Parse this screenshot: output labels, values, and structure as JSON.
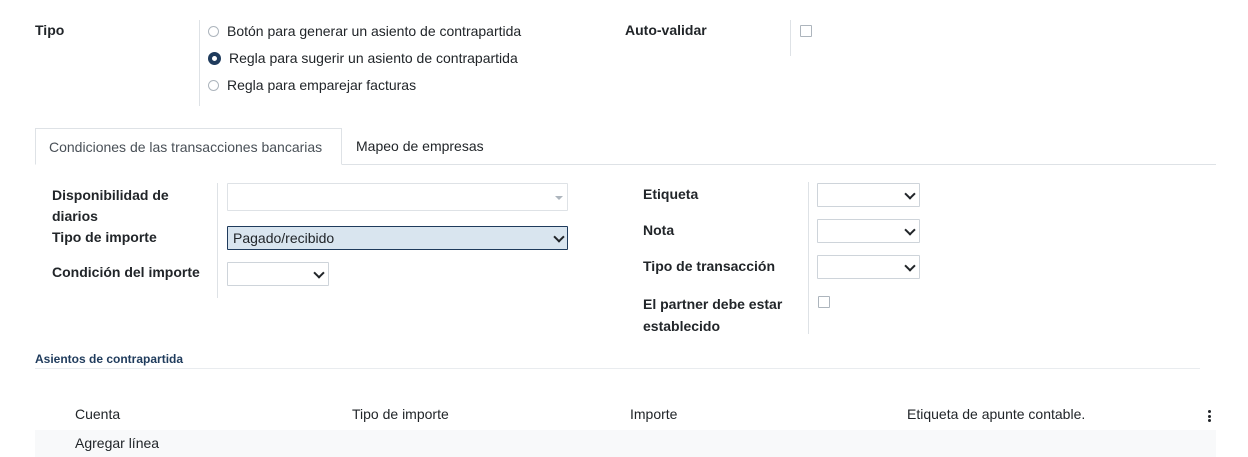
{
  "tipo": {
    "label": "Tipo",
    "options": [
      {
        "label": "Botón para generar un asiento de contrapartida",
        "checked": false
      },
      {
        "label": "Regla para sugerir un asiento de contrapartida",
        "checked": true
      },
      {
        "label": "Regla para emparejar facturas",
        "checked": false
      }
    ]
  },
  "auto_validar": {
    "label": "Auto-validar",
    "checked": false
  },
  "tabs": [
    {
      "label": "Condiciones de las transacciones bancarias",
      "active": true
    },
    {
      "label": "Mapeo de empresas",
      "active": false
    }
  ],
  "conditions": {
    "disponibilidad": {
      "label_line1": "Disponibilidad de",
      "label_line2": "diarios",
      "value": ""
    },
    "tipo_importe": {
      "label": "Tipo de importe",
      "value": "Pagado/recibido"
    },
    "condicion_importe": {
      "label": "Condición del importe",
      "value": ""
    },
    "etiqueta": {
      "label": "Etiqueta",
      "value": ""
    },
    "nota": {
      "label": "Nota",
      "value": ""
    },
    "tipo_transaccion": {
      "label": "Tipo de transacción",
      "value": ""
    },
    "partner": {
      "label_line1": "El partner debe estar",
      "label_line2": "establecido",
      "checked": false
    }
  },
  "contrapartida": {
    "title": "Asientos de contrapartida",
    "columns": [
      "Cuenta",
      "Tipo de importe",
      "Importe",
      "Etiqueta de apunte contable."
    ],
    "add_line": "Agregar línea"
  },
  "colors": {
    "accent": "#1f3b5c",
    "highlight_field": "#d9e5ef"
  }
}
